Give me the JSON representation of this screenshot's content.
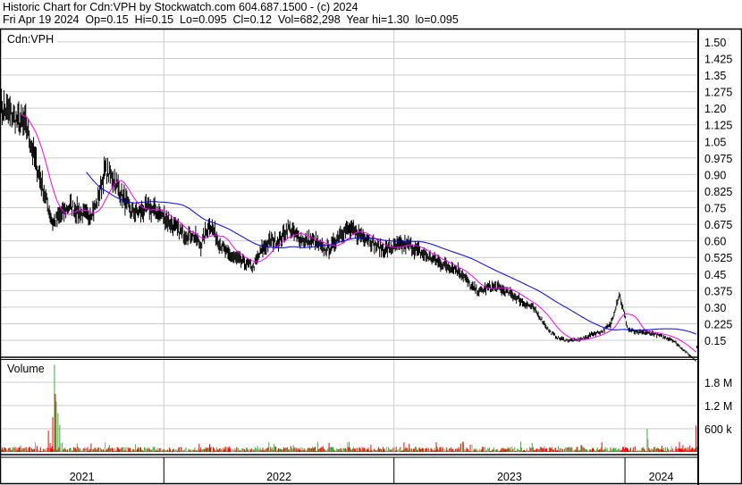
{
  "header": {
    "line1": "Historic Chart for Cdn:VPH by Stockwatch.com 604.687.1500 - (c) 2024",
    "line2": "Fri Apr 19 2024  Op=0.15  Hi=0.15  Lo=0.095  Cl=0.12  Vol=682,298  Year hi=1.30  lo=0.095"
  },
  "chart_data": {
    "type": "line",
    "symbol_label": "Cdn:VPH",
    "volume_label": "Volume",
    "colors": {
      "price": "#000000",
      "ma_short": "#ff00ff",
      "ma_long": "#0000ff",
      "vol_up": "#33b233",
      "vol_down": "#ff0000",
      "vol_flat": "#a0a0a0",
      "grid": "#cccccc"
    },
    "price_ticks": [
      "1.50",
      "1.425",
      "1.35",
      "1.275",
      "1.20",
      "1.125",
      "1.05",
      "0.975",
      "0.90",
      "0.825",
      "0.75",
      "0.675",
      "0.60",
      "0.525",
      "0.45",
      "0.375",
      "0.30",
      "0.225",
      "0.15"
    ],
    "price_range": [
      0.12,
      1.53
    ],
    "volume_ticks": [
      {
        "value": 1800000,
        "label": "1.8 M"
      },
      {
        "value": 1200000,
        "label": "1.2 M"
      },
      {
        "value": 600000,
        "label": "600 k"
      }
    ],
    "volume_range": [
      0,
      2400000
    ],
    "years": [
      {
        "label": "2021",
        "start": 0,
        "end": 188
      },
      {
        "label": "2022",
        "start": 188,
        "end": 452
      },
      {
        "label": "2023",
        "start": 452,
        "end": 717
      },
      {
        "label": "2024",
        "start": 717,
        "end": 800
      }
    ],
    "total_days": 800,
    "close_every_10_days": [
      1.2,
      1.18,
      1.14,
      1.12,
      0.96,
      0.82,
      0.68,
      0.72,
      0.76,
      0.73,
      0.71,
      0.76,
      0.92,
      0.88,
      0.8,
      0.73,
      0.73,
      0.75,
      0.73,
      0.7,
      0.66,
      0.63,
      0.63,
      0.58,
      0.68,
      0.6,
      0.54,
      0.52,
      0.5,
      0.48,
      0.56,
      0.6,
      0.6,
      0.66,
      0.62,
      0.6,
      0.6,
      0.56,
      0.57,
      0.64,
      0.65,
      0.63,
      0.62,
      0.58,
      0.56,
      0.57,
      0.58,
      0.58,
      0.55,
      0.53,
      0.51,
      0.49,
      0.48,
      0.45,
      0.39,
      0.37,
      0.39,
      0.39,
      0.37,
      0.35,
      0.32,
      0.3,
      0.25,
      0.19,
      0.16,
      0.15,
      0.15,
      0.16,
      0.18,
      0.19,
      0.22,
      0.36,
      0.2,
      0.185,
      0.185,
      0.18,
      0.165,
      0.155,
      0.12
    ],
    "ma_short_days": 25,
    "ma_long_days": 100,
    "volume_base": 90000,
    "volume_spikes": [
      [
        55,
        550000
      ],
      [
        60,
        900000
      ],
      [
        62,
        2250000
      ],
      [
        63,
        1500000
      ],
      [
        64,
        1300000
      ],
      [
        66,
        1000000
      ],
      [
        68,
        700000
      ],
      [
        40,
        250000
      ],
      [
        120,
        250000
      ],
      [
        240,
        200000
      ],
      [
        308,
        250000
      ],
      [
        400,
        260000
      ],
      [
        500,
        250000
      ],
      [
        530,
        250000
      ],
      [
        610,
        230000
      ],
      [
        690,
        250000
      ],
      [
        742,
        600000
      ],
      [
        743,
        330000
      ],
      [
        770,
        150000
      ],
      [
        798,
        682298
      ]
    ]
  }
}
